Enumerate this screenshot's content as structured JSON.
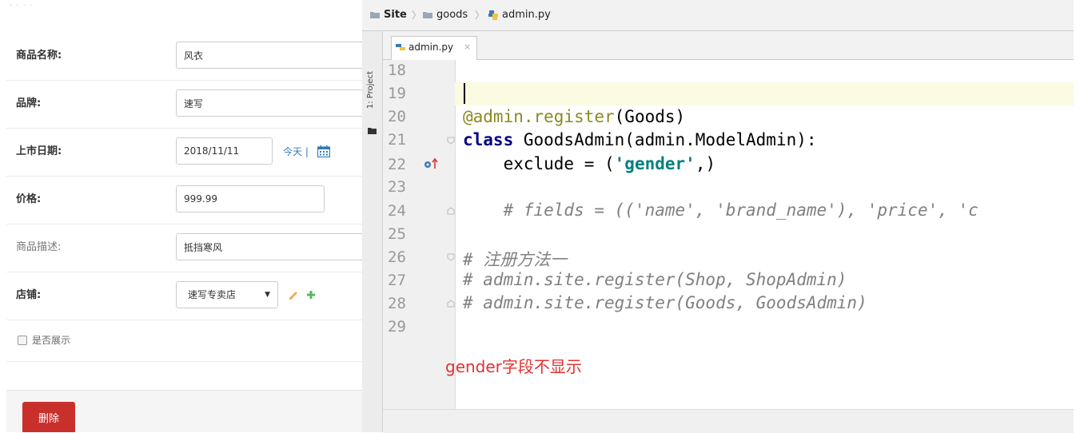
{
  "form": {
    "fields": [
      {
        "label": "商品名称:",
        "value": "风衣"
      },
      {
        "label": "品牌:",
        "value": "速写"
      },
      {
        "label": "上市日期:",
        "value": "2018/11/11",
        "shortcut": "今天 |"
      },
      {
        "label": "价格:",
        "value": "999.99"
      },
      {
        "label": "商品描述:",
        "value": "抵挡寒风"
      },
      {
        "label": "店铺:",
        "value": "速写专卖店"
      }
    ],
    "checkbox_label": "是否展示",
    "delete_label": "删除"
  },
  "ide": {
    "breadcrumb": [
      "Site",
      "goods",
      "admin.py"
    ],
    "tool_window_tab": "1: Project",
    "file_tab": "admin.py",
    "file_tab_close": "×",
    "line_numbers": [
      "18",
      "19",
      "20",
      "21",
      "22",
      "23",
      "24",
      "25",
      "26",
      "27",
      "28",
      "29"
    ],
    "code": {
      "decorator": "@admin.register",
      "decorator_args": "(Goods)",
      "class_kw": "class",
      "class_rest": " GoodsAdmin(admin.ModelAdmin):",
      "exclude_pre": "    exclude = (",
      "exclude_str": "'gender'",
      "exclude_post": ",)",
      "comment_24": "    # fields = (('name', 'brand_name'), 'price', 'c",
      "comment_26": "# 注册方法一",
      "comment_27": "# admin.site.register(Shop, ShopAdmin)",
      "comment_28": "# admin.site.register(Goods, GoodsAdmin)"
    },
    "annotation": "gender字段不显示"
  },
  "colors": {
    "accent_red": "#c9302c",
    "link_blue": "#337ab7",
    "annotation_red": "#e53030",
    "current_line": "#fcfae1"
  }
}
